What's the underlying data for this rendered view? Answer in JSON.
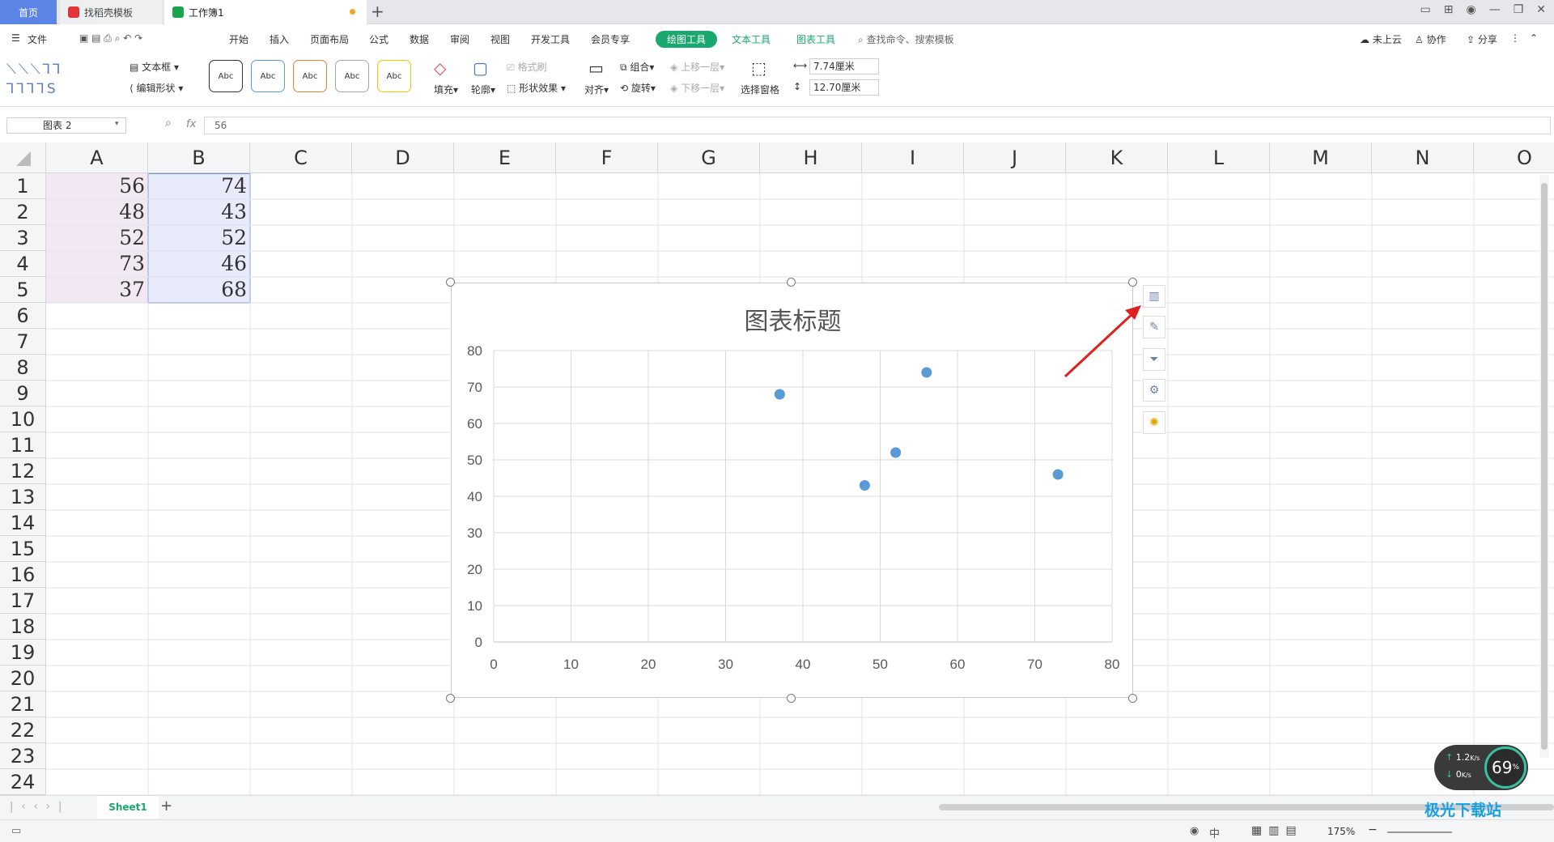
{
  "tabs": {
    "home": "首页",
    "template": "找稻壳模板",
    "workbook": "工作簿1",
    "add": "+"
  },
  "menu": {
    "file": "文件",
    "items": [
      "开始",
      "插入",
      "页面布局",
      "公式",
      "数据",
      "审阅",
      "视图",
      "开发工具",
      "会员专享"
    ],
    "draw_tools": "绘图工具",
    "text_tools": "文本工具",
    "chart_tools": "图表工具",
    "search_placeholder": "查找命令、搜索模板",
    "cloud": "未上云",
    "collab": "协作",
    "share": "分享"
  },
  "ribbon": {
    "textbox": "文本框",
    "edit_shape": "编辑形状",
    "style_sample": "Abc",
    "fill": "填充",
    "outline": "轮廓",
    "format_painter": "格式刷",
    "shape_effect": "形状效果",
    "align": "对齐",
    "group": "组合",
    "rotate": "旋转",
    "bring_forward": "上移一层",
    "send_backward": "下移一层",
    "selection_pane": "选择窗格",
    "width": "7.74厘米",
    "height": "12.70厘米",
    "style_colors": [
      "#333333",
      "#5b9bd5",
      "#ed7d31",
      "#a5a5a5",
      "#ffc000"
    ]
  },
  "formula": {
    "name_box": "图表 2",
    "fx": "fx",
    "value": "56"
  },
  "columns": [
    "A",
    "B",
    "C",
    "D",
    "E",
    "F",
    "G",
    "H",
    "I",
    "J",
    "K",
    "L",
    "M",
    "N",
    "O"
  ],
  "rows": [
    "1",
    "2",
    "3",
    "4",
    "5",
    "6",
    "7",
    "8",
    "9",
    "10",
    "11",
    "12",
    "13",
    "14",
    "15",
    "16",
    "17",
    "18",
    "19",
    "20",
    "21",
    "22",
    "23",
    "24"
  ],
  "cells": {
    "A": [
      "56",
      "48",
      "52",
      "73",
      "37"
    ],
    "B": [
      "74",
      "43",
      "52",
      "46",
      "68"
    ]
  },
  "chart_data": {
    "type": "scatter",
    "title": "图表标题",
    "x": [
      56,
      48,
      52,
      73,
      37
    ],
    "y": [
      74,
      43,
      52,
      46,
      68
    ],
    "xlim": [
      0,
      80
    ],
    "ylim": [
      0,
      80
    ],
    "xticks": [
      "0",
      "10",
      "20",
      "30",
      "40",
      "50",
      "60",
      "70",
      "80"
    ],
    "yticks": [
      "0",
      "10",
      "20",
      "30",
      "40",
      "50",
      "60",
      "70",
      "80"
    ],
    "grid": true,
    "marker_color": "#5b9bd5"
  },
  "sheet_tabs": {
    "active": "Sheet1",
    "add": "+"
  },
  "status": {
    "zoom": "175%",
    "input_mode": "中"
  },
  "net_widget": {
    "up": "1.2",
    "down": "0",
    "unit": "K/s",
    "percent": "69",
    "pct_sign": "%"
  },
  "watermark": "极光下载站"
}
